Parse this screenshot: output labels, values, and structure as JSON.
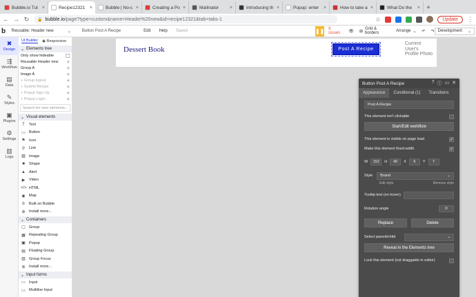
{
  "browser": {
    "tabs": [
      {
        "label": "Bubble.io Tut",
        "color": "#e53935",
        "active": false
      },
      {
        "label": "Recipe12321",
        "color": "#ffffff",
        "active": true
      },
      {
        "label": "Bubble | No-c",
        "color": "#ffffff",
        "active": false
      },
      {
        "label": "Creating a Po",
        "color": "#e53935",
        "active": false
      },
      {
        "label": "Mailinator",
        "color": "#555555",
        "active": false
      },
      {
        "label": "Introducing th",
        "color": "#333333",
        "active": false
      },
      {
        "label": "Popup: enter",
        "color": "#ffffff",
        "active": false
      },
      {
        "label": "How to take a",
        "color": "#d32f2f",
        "active": false
      },
      {
        "label": "What Do the",
        "color": "#222222",
        "active": false
      }
    ],
    "url_domain": "bubble.io",
    "url_rest": "/page?type=custom&name=Header%20new&id=recipe12321&tab=tabs-1",
    "update_label": "Update"
  },
  "editor_bar": {
    "page_selector": "Reusable: Header new",
    "element_selector": "Button Post A Recipe",
    "menu": [
      "Edit",
      "Help"
    ],
    "saved": "Saved",
    "issues": "6 issues",
    "grid_borders": "Grid & borders",
    "arrange": "Arrange",
    "development": "Development"
  },
  "rail": [
    {
      "label": "Design",
      "icon": "✖",
      "active": true
    },
    {
      "label": "Workflow",
      "icon": "⇶",
      "active": false
    },
    {
      "label": "Data",
      "icon": "▤",
      "active": false
    },
    {
      "label": "Styles",
      "icon": "✎",
      "active": false
    },
    {
      "label": "Plugins",
      "icon": "▣",
      "active": false
    },
    {
      "label": "Settings",
      "icon": "⚙",
      "active": false
    },
    {
      "label": "Logs",
      "icon": "▥",
      "active": false
    }
  ],
  "panel": {
    "tabs": [
      "UI Builder",
      "Responsive"
    ],
    "elements_tree": "Elements tree",
    "only_show_hideable": "Only show hideable",
    "tree": [
      {
        "label": "Reusable Header new",
        "dim": false
      },
      {
        "label": "Group A",
        "dim": false
      },
      {
        "label": "Image A",
        "dim": false
      },
      {
        "label": "+ Group logout",
        "dim": true
      },
      {
        "label": "+ Submit Recipe",
        "dim": true
      },
      {
        "label": "+ Popup Sign Up",
        "dim": true
      },
      {
        "label": "+ Popup Login",
        "dim": true
      }
    ],
    "search_placeholder": "Search for new elements...",
    "visual_elements": "Visual elements",
    "visual": [
      {
        "label": "Text",
        "icon": "T"
      },
      {
        "label": "Button",
        "icon": "▭"
      },
      {
        "label": "Icon",
        "icon": "⚑"
      },
      {
        "label": "Link",
        "icon": "⚲"
      },
      {
        "label": "Image",
        "icon": "▨"
      },
      {
        "label": "Shape",
        "icon": "■"
      },
      {
        "label": "Alert",
        "icon": "▲"
      },
      {
        "label": "Video",
        "icon": "▶"
      },
      {
        "label": "HTML",
        "icon": "</>"
      },
      {
        "label": "Map",
        "icon": "◉"
      },
      {
        "label": "Built on Bubble",
        "icon": "b"
      },
      {
        "label": "Install more...",
        "icon": "⊕"
      }
    ],
    "containers": "Containers",
    "container_items": [
      {
        "label": "Group",
        "icon": "▢"
      },
      {
        "label": "Repeating Group",
        "icon": "▦"
      },
      {
        "label": "Popup",
        "icon": "▣"
      },
      {
        "label": "Floating Group",
        "icon": "▤"
      },
      {
        "label": "Group Focus",
        "icon": "▥"
      },
      {
        "label": "Install more...",
        "icon": "⊕"
      }
    ],
    "input_forms": "Input forms",
    "input_items": [
      {
        "label": "Input",
        "icon": "▭"
      },
      {
        "label": "Multiline Input",
        "icon": "▭"
      }
    ]
  },
  "canvas": {
    "title": "Dessert Book",
    "button_label": "Post A Recipe",
    "profile_lines": [
      "Current",
      "User's",
      "Profile Photo"
    ]
  },
  "inspector": {
    "title": "Button Post A Recipe",
    "tabs": [
      "Appearance",
      "Conditional (1)",
      "Transitions"
    ],
    "label_value": "Post A Recipe",
    "not_clickable": "This element isn't clickable",
    "workflow_btn": "Start/Edit workflow",
    "visible_on_load": "This element is visible on page load",
    "fixed_width": "Make this element fixed-width",
    "w_label": "W",
    "w": "152",
    "h_label": "H",
    "h": "40",
    "x_label": "X",
    "x": "6",
    "y_label": "Y",
    "y": "7",
    "style_label": "Style",
    "style_value": "Brand",
    "edit_style": "Edit style",
    "remove_style": "Remove style",
    "tooltip": "Tooltip text (on hover)",
    "rotation": "Rotation angle",
    "rotation_value": "0",
    "replace": "Replace",
    "delete": "Delete",
    "parent": "Select parent/child",
    "reveal": "Reveal in the Elements tree",
    "lock": "Lock this element (not draggable in editor)"
  }
}
